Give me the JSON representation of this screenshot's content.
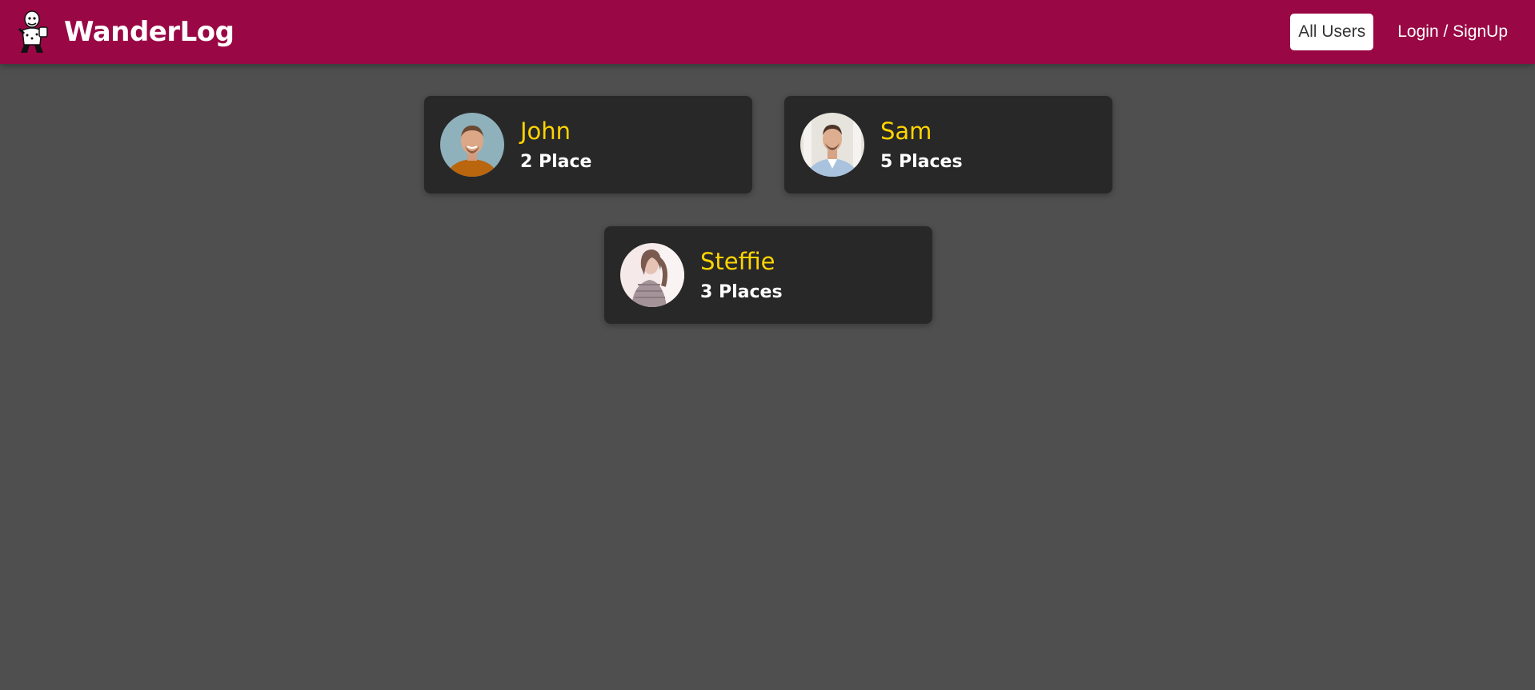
{
  "header": {
    "brand_title": "WanderLog",
    "logo_icon": "traveler-logo-icon",
    "nav": [
      {
        "label": "All Users",
        "active": true
      },
      {
        "label": "Login / SignUp",
        "active": false
      }
    ]
  },
  "users": [
    {
      "name": "John",
      "places": "2 Place",
      "avatar": "avatar-photo"
    },
    {
      "name": "Sam",
      "places": "5 Places",
      "avatar": "avatar-photo"
    },
    {
      "name": "Steffie",
      "places": "3 Places",
      "avatar": "avatar-photo"
    }
  ],
  "colors": {
    "header_bg": "#990745",
    "page_bg": "#4f4f4f",
    "card_bg": "#282828",
    "name_accent": "#ffd400"
  }
}
